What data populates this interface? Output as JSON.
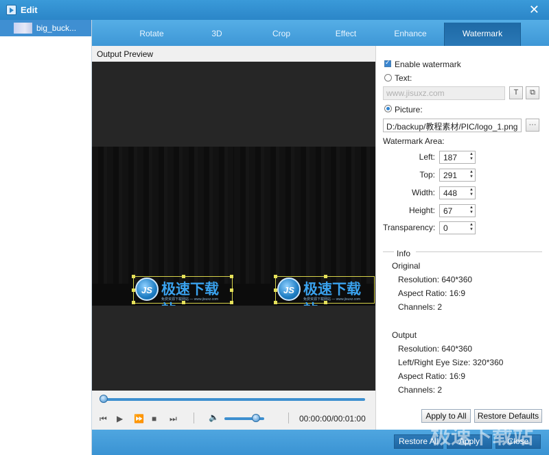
{
  "window": {
    "title": "Edit",
    "close_glyph": "✕"
  },
  "sidebar": {
    "items": [
      {
        "label": "big_buck..."
      }
    ]
  },
  "tabs": [
    {
      "label": "Rotate",
      "active": false
    },
    {
      "label": "3D",
      "active": false
    },
    {
      "label": "Crop",
      "active": false
    },
    {
      "label": "Effect",
      "active": false
    },
    {
      "label": "Enhance",
      "active": false
    },
    {
      "label": "Watermark",
      "active": true
    }
  ],
  "preview": {
    "label": "Output Preview",
    "watermark_logo_text": "JS",
    "watermark_text": "极速下载站",
    "watermark_sub": "免费资源下载网站 — www.jisuxz.com",
    "timecode": "00:00:00/00:01:00",
    "seek_position": 0,
    "volume_level": 0.8
  },
  "icons": {
    "prev": "⏮",
    "play": "▶",
    "fast_forward": "⏩",
    "stop": "■",
    "next": "⏭",
    "volume": "🔈",
    "text_style": "T",
    "copy": "⧉",
    "browse": "···"
  },
  "watermark": {
    "enable_label": "Enable watermark",
    "enabled": true,
    "text_label": "Text:",
    "text_value": "www.jisuxz.com",
    "picture_label": "Picture:",
    "picture_path": "D:/backup/教程素材/PIC/logo_1.png",
    "area_label": "Watermark Area:",
    "left_label": "Left:",
    "left_value": "187",
    "top_label": "Top:",
    "top_value": "291",
    "width_label": "Width:",
    "width_value": "448",
    "height_label": "Height:",
    "height_value": "67",
    "transparency_label": "Transparency:",
    "transparency_value": "0"
  },
  "info": {
    "header": "Info",
    "original": {
      "label": "Original",
      "resolution": "Resolution: 640*360",
      "aspect": "Aspect Ratio: 16:9",
      "channels": "Channels: 2"
    },
    "output": {
      "label": "Output",
      "resolution": "Resolution: 640*360",
      "eye_size": "Left/Right Eye Size: 320*360",
      "aspect": "Aspect Ratio: 16:9",
      "channels": "Channels: 2"
    }
  },
  "buttons": {
    "apply_to_all": "Apply to All",
    "restore_defaults": "Restore Defaults",
    "restore_all": "Restore All",
    "apply": "Apply",
    "close": "Close"
  },
  "overlay_watermark": "极速下载站",
  "colors": {
    "titlebar": "#2b86c8",
    "tab_active": "#1e6aa6",
    "accent": "#3d8fcf"
  }
}
